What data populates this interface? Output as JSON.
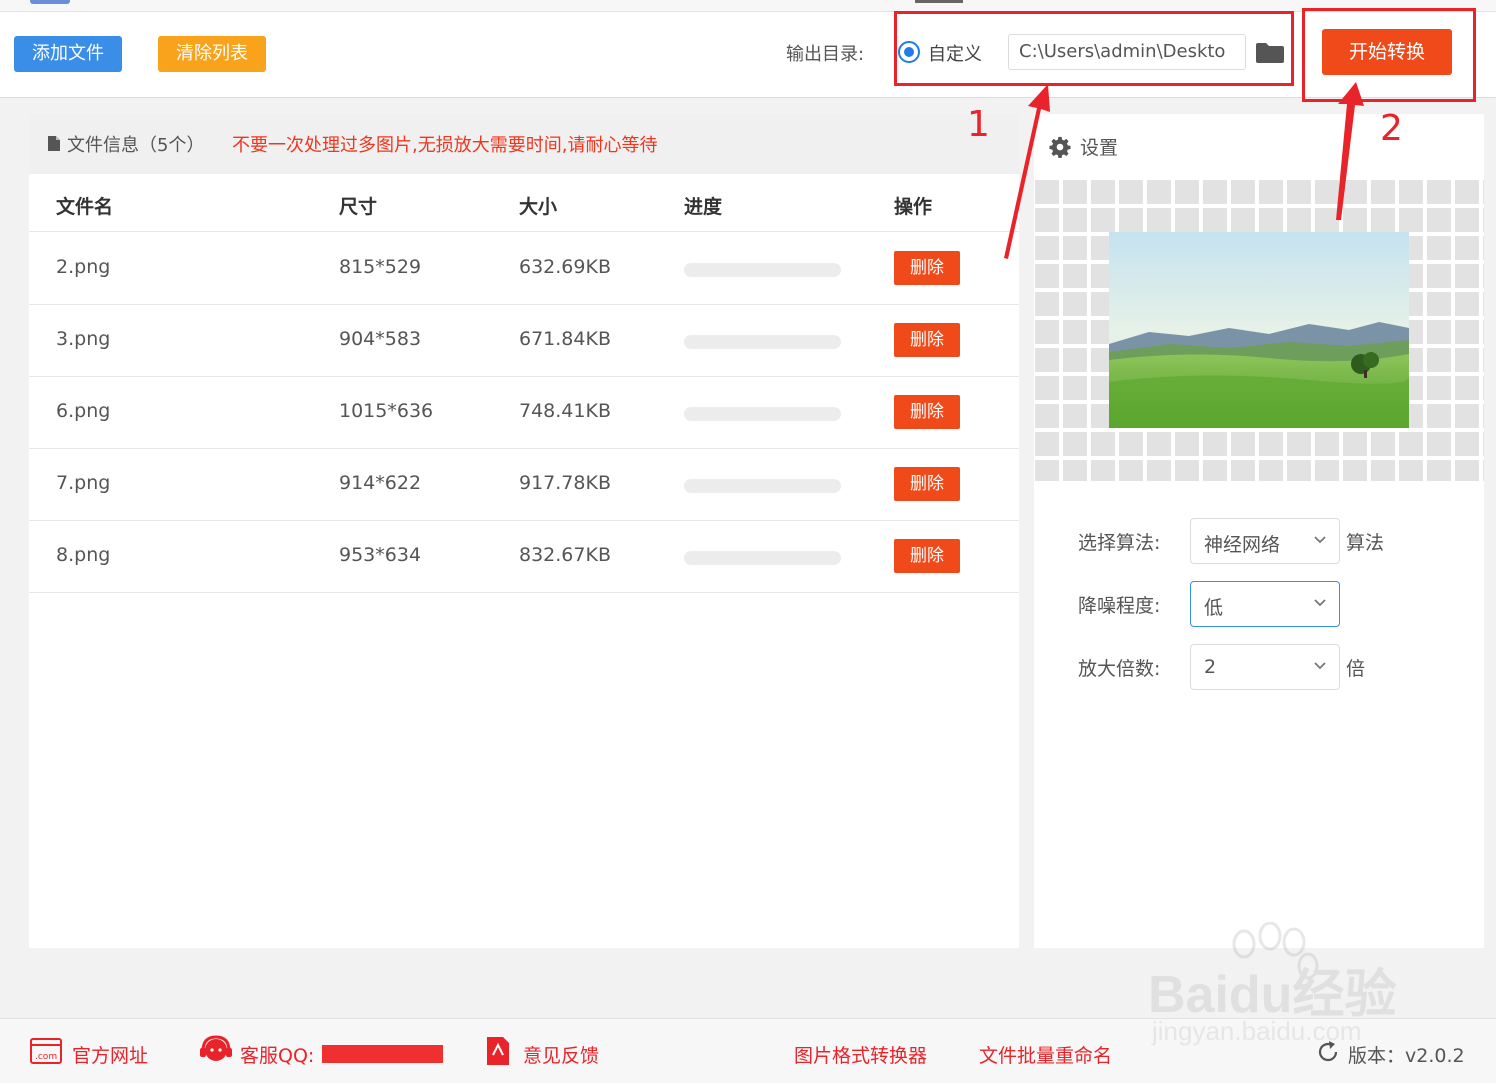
{
  "toolbar": {
    "add_files": "添加文件",
    "clear_list": "清除列表",
    "output_dir_label": "输出目录:",
    "custom_option": "自定义",
    "output_path": "C:\\Users\\admin\\Deskto",
    "start_convert": "开始转换"
  },
  "annotations": {
    "one": "1",
    "two": "2",
    "color": "#e8242a"
  },
  "file_panel": {
    "title": "文件信息（5个）",
    "warning": "不要一次处理过多图片,无损放大需要时间,请耐心等待",
    "columns": {
      "name": "文件名",
      "size": "尺寸",
      "filesize": "大小",
      "progress": "进度",
      "action": "操作"
    },
    "delete_label": "删除",
    "rows": [
      {
        "name": "2.png",
        "dims": "815*529",
        "filesize": "632.69KB",
        "progress": 0
      },
      {
        "name": "3.png",
        "dims": "904*583",
        "filesize": "671.84KB",
        "progress": 0
      },
      {
        "name": "6.png",
        "dims": "1015*636",
        "filesize": "748.41KB",
        "progress": 0
      },
      {
        "name": "7.png",
        "dims": "914*622",
        "filesize": "917.78KB",
        "progress": 0
      },
      {
        "name": "8.png",
        "dims": "953*634",
        "filesize": "832.67KB",
        "progress": 0
      }
    ]
  },
  "settings": {
    "title": "设置",
    "algorithm_label": "选择算法:",
    "algorithm_value": "神经网络",
    "algorithm_suffix": "算法",
    "denoise_label": "降噪程度:",
    "denoise_value": "低",
    "scale_label": "放大倍数:",
    "scale_value": "2",
    "scale_suffix": "倍"
  },
  "footer": {
    "website": "官方网址",
    "service_qq": "客服QQ:",
    "feedback": "意见反馈",
    "format_converter": "图片格式转换器",
    "batch_rename": "文件批量重命名",
    "version": "版本：v2.0.2"
  },
  "watermark": {
    "brand": "Baidu经验",
    "url": "jingyan.baidu.com"
  },
  "colors": {
    "primary": "#3b8ee8",
    "accent_orange": "#f9a21b",
    "danger": "#f04a1a",
    "warning_text": "#f0361f"
  }
}
